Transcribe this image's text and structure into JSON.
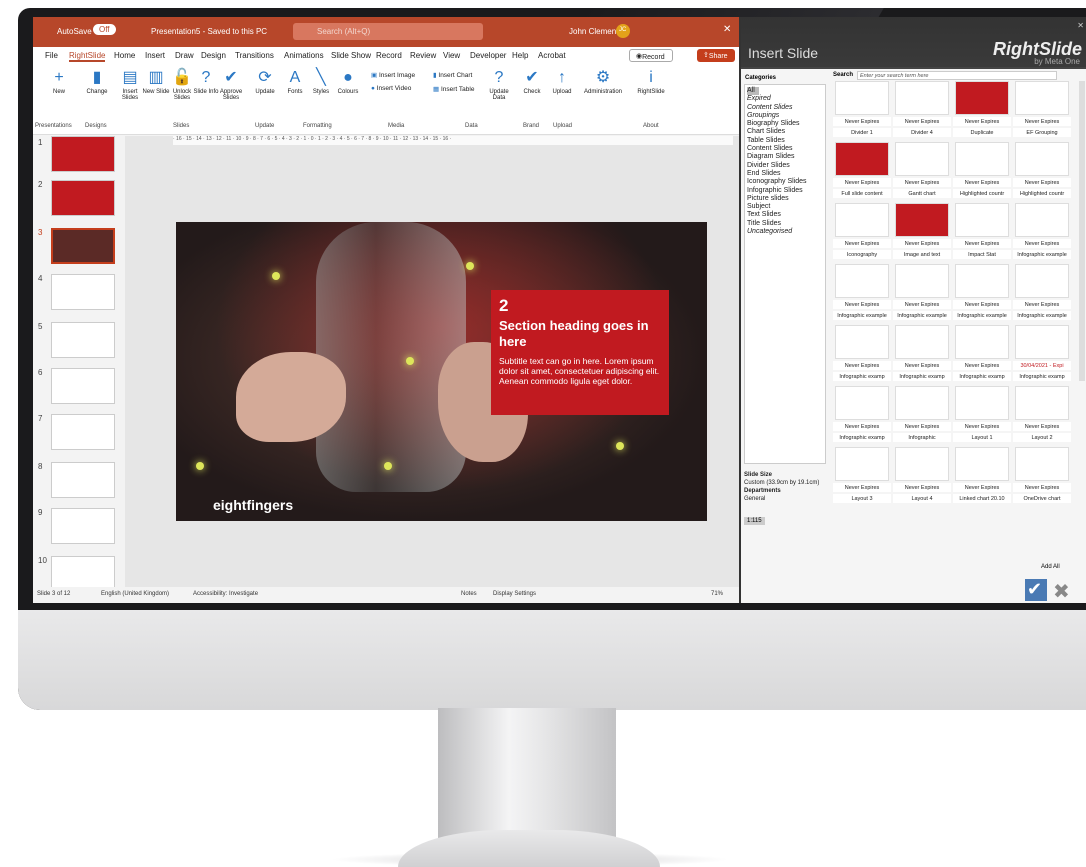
{
  "titlebar": {
    "autosave": "AutoSave",
    "toggle": "Off",
    "file": "Presentation5 - Saved to this PC",
    "search": "Search (Alt+Q)",
    "user": "John Clements",
    "initials": "JC"
  },
  "menu": [
    "File",
    "RightSlide",
    "Home",
    "Insert",
    "Draw",
    "Design",
    "Transitions",
    "Animations",
    "Slide Show",
    "Record",
    "Review",
    "View",
    "Developer",
    "Help",
    "Acrobat"
  ],
  "record_label": "Record",
  "share_label": "Share",
  "ribbon": {
    "buttons": [
      {
        "label": "New",
        "icon": "+"
      },
      {
        "label": "Change",
        "icon": "▮"
      },
      {
        "label": "Insert Slides",
        "icon": "▤"
      },
      {
        "label": "New Slide",
        "icon": "▥"
      },
      {
        "label": "Unlock Slides",
        "icon": "🔓"
      },
      {
        "label": "Slide Info",
        "icon": "?"
      },
      {
        "label": "Approve Slides",
        "icon": "✔"
      },
      {
        "label": "Update",
        "icon": "⟳"
      },
      {
        "label": "Fonts",
        "icon": "A"
      },
      {
        "label": "Styles",
        "icon": "╲"
      },
      {
        "label": "Colours",
        "icon": "●"
      },
      {
        "label": "Insert Image",
        "icon": ""
      },
      {
        "label": "Insert Video",
        "icon": ""
      },
      {
        "label": "Insert Chart",
        "icon": ""
      },
      {
        "label": "Insert Table",
        "icon": ""
      },
      {
        "label": "Update Data",
        "icon": "?"
      },
      {
        "label": "Check",
        "icon": "✔"
      },
      {
        "label": "Upload",
        "icon": "↑"
      },
      {
        "label": "Administration",
        "icon": "⚙"
      },
      {
        "label": "RightSlide",
        "icon": "i"
      }
    ],
    "groups": [
      "Presentations",
      "Designs",
      "Slides",
      "Update",
      "Formatting",
      "Media",
      "Data",
      "Brand",
      "Upload",
      "About"
    ]
  },
  "slide": {
    "number": "2",
    "heading": "Section heading goes in here",
    "subtitle": "Subtitle text can go in here. Lorem ipsum dolor sit amet, consectetuer adipiscing elit. Aenean commodo ligula eget dolor.",
    "logo": "eightfingers"
  },
  "thumbs": [
    "1",
    "2",
    "3",
    "4",
    "5",
    "6",
    "7",
    "8",
    "9",
    "10"
  ],
  "statusbar": {
    "slide": "Slide 3 of 12",
    "lang": "English (United Kingdom)",
    "access": "Accessibility: Investigate",
    "notes": "Notes",
    "display": "Display Settings",
    "zoom": "71%"
  },
  "panel": {
    "title": "Insert Slide",
    "logo": "RightSlide",
    "logo_sub": "by Meta One",
    "categories_label": "Categories",
    "search_label": "Search",
    "search_placeholder": "Enter your search term here",
    "categories": [
      "All",
      "Expired",
      "Content Slides",
      "Groupings",
      "Biography Slides",
      "Chart Slides",
      "Table Slides",
      "Content Slides",
      "Diagram Slides",
      "Divider Slides",
      "End Slides",
      "Iconography Slides",
      "Infographic Slides",
      "Picture slides",
      "Subject",
      "Text Slides",
      "Title Slides",
      "Uncategorised"
    ],
    "cards": [
      [
        "Never Expires",
        "Divider 1"
      ],
      [
        "Never Expires",
        "Divider 4"
      ],
      [
        "Never Expires",
        "Duplicate"
      ],
      [
        "Never Expires",
        "EF Grouping"
      ],
      [
        "Never Expires",
        "Full slide content"
      ],
      [
        "Never Expires",
        "Gantt chart"
      ],
      [
        "Never Expires",
        "Highlighted countr"
      ],
      [
        "Never Expires",
        "Highlighted countr"
      ],
      [
        "Never Expires",
        "Iconography"
      ],
      [
        "Never Expires",
        "Image and text"
      ],
      [
        "Never Expires",
        "Impact Stat"
      ],
      [
        "Never Expires",
        "Infographic example"
      ],
      [
        "Never Expires",
        "Infographic example"
      ],
      [
        "Never Expires",
        "Infographic example"
      ],
      [
        "Never Expires",
        "Infographic example"
      ],
      [
        "Never Expires",
        "Infographic example"
      ],
      [
        "Never Expires",
        "Infographic examp"
      ],
      [
        "Never Expires",
        "Infographic examp"
      ],
      [
        "Never Expires",
        "Infographic examp"
      ],
      [
        "30/04/2021 - Expi",
        "Infographic examp"
      ],
      [
        "Never Expires",
        "Infographic examp"
      ],
      [
        "Never Expires",
        "Infographic"
      ],
      [
        "Never Expires",
        "Layout 1"
      ],
      [
        "Never Expires",
        "Layout 2"
      ],
      [
        "Never Expires",
        "Layout 3"
      ],
      [
        "Never Expires",
        "Layout 4"
      ],
      [
        "Never Expires",
        "Linked chart 20.10"
      ],
      [
        "Never Expires",
        "OneDrive chart"
      ]
    ],
    "slide_size_label": "Slide Size",
    "slide_size": "Custom (33.9cm by 19.1cm)",
    "departments_label": "Departments",
    "department": "General",
    "count": "1:115",
    "add_all": "Add All"
  }
}
